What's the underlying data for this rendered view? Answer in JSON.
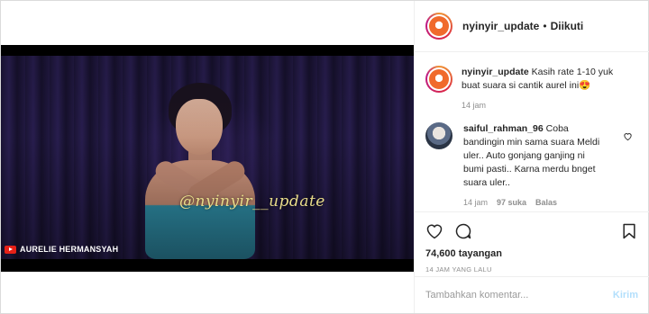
{
  "header": {
    "username": "nyinyir_update",
    "separator": "•",
    "follow_status": "Diikuti"
  },
  "video": {
    "watermark": "@nyinyir__update",
    "channel": "AURELIE HERMANSYAH"
  },
  "caption": {
    "username": "nyinyir_update",
    "text": "Kasih rate 1-10 yuk buat suara si cantik aurel ini😍",
    "time": "14 jam"
  },
  "comment": {
    "username": "saiful_rahman_96",
    "text": "Coba bandingin min sama suara Meldi uler.. Auto gonjang ganjing ni bumi pasti.. Karna merdu bnget suara uler..",
    "time": "14 jam",
    "likes": "97 suka",
    "reply": "Balas"
  },
  "stats": {
    "views": "74,600 tayangan",
    "posted": "14 JAM YANG LALU"
  },
  "add_comment": {
    "placeholder": "Tambahkan komentar...",
    "send": "Kirim"
  },
  "icons": {
    "like": "heart-icon",
    "comment": "comment-icon",
    "save": "bookmark-icon",
    "comment_like": "heart-icon",
    "channel": "youtube-icon"
  },
  "colors": {
    "send_disabled": "#b2dffc",
    "muted": "#8e8e8e",
    "youtube": "#e62117",
    "watermark": "#e8dc8a"
  }
}
